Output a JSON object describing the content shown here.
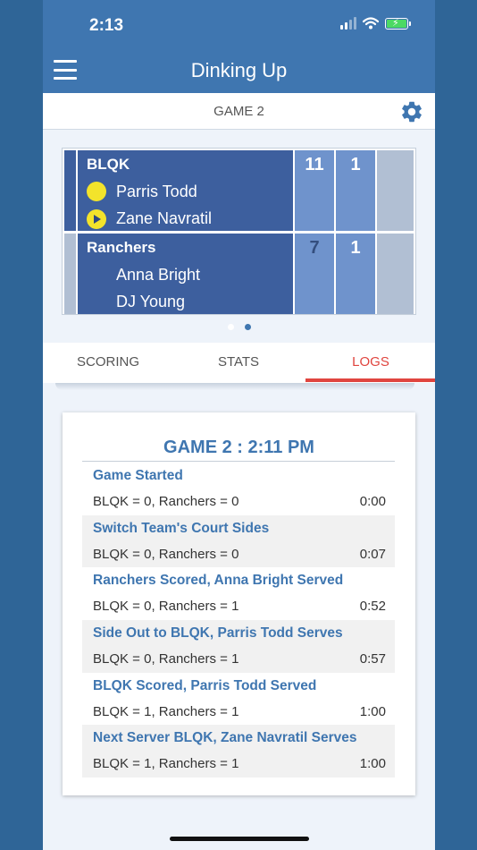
{
  "status_bar": {
    "time": "2:13"
  },
  "header": {
    "title": "Dinking Up"
  },
  "game_bar": {
    "label": "GAME 2"
  },
  "scoreboard": {
    "teams": [
      {
        "name": "BLQK",
        "score": "11",
        "games": "1",
        "players": [
          "Parris Todd",
          "Zane Navratil"
        ]
      },
      {
        "name": "Ranchers",
        "score": "7",
        "games": "1",
        "players": [
          "Anna Bright",
          "DJ Young"
        ]
      }
    ]
  },
  "tabs": [
    {
      "label": "SCORING"
    },
    {
      "label": "STATS"
    },
    {
      "label": "LOGS",
      "active": true
    }
  ],
  "log": {
    "title": "GAME 2 : 2:11 PM",
    "entries": [
      {
        "event": "Game Started",
        "score": "BLQK = 0, Ranchers = 0",
        "time": "0:00"
      },
      {
        "event": "Switch Team's Court Sides",
        "score": "BLQK = 0, Ranchers = 0",
        "time": "0:07"
      },
      {
        "event": "Ranchers Scored, Anna Bright Served",
        "score": "BLQK = 0, Ranchers = 1",
        "time": "0:52"
      },
      {
        "event": "Side Out to BLQK, Parris Todd Serves",
        "score": "BLQK = 0, Ranchers = 1",
        "time": "0:57"
      },
      {
        "event": "BLQK Scored, Parris Todd Served",
        "score": "BLQK = 1, Ranchers = 1",
        "time": "1:00"
      },
      {
        "event": "Next Server BLQK, Zane Navratil Serves",
        "score": "BLQK = 1, Ranchers = 1",
        "time": "1:00"
      }
    ]
  },
  "colors": {
    "accent": "#3f76b0",
    "team_box": "#3d5f9e",
    "score_cell": "#6f93cc",
    "active_tab": "#e0453f",
    "ball": "#f3e32b"
  },
  "icons": [
    "menu-icon",
    "gear-icon",
    "ball-icon",
    "serve-icon",
    "signal-icon",
    "wifi-icon",
    "battery-icon"
  ]
}
